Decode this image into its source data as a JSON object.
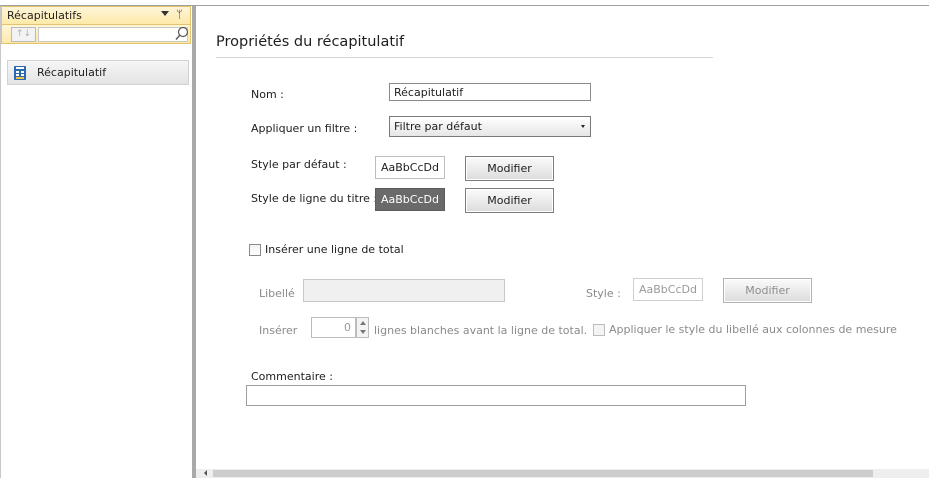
{
  "sidebar": {
    "title": "Récapitulatifs",
    "sort_icon": "↑↓",
    "search_placeholder": "",
    "items": [
      {
        "label": "Récapitulatif",
        "icon": "summary-table-icon"
      }
    ]
  },
  "panel": {
    "title": "Propriétés du récapitulatif",
    "name_label": "Nom :",
    "name_value": "Récapitulatif",
    "filter_label": "Appliquer un filtre :",
    "filter_value": "Filtre par défaut",
    "default_style_label": "Style par défaut :",
    "default_style_preview": "AaBbCcDd",
    "default_style_button": "Modifier",
    "title_style_label": "Style de ligne du titre :",
    "title_style_preview": "AaBbCcDd",
    "title_style_button": "Modifier",
    "total_checkbox_label": "Insérer une ligne de total",
    "total_checked": false,
    "libelle_label": "Libellé",
    "libelle_value": "",
    "total_style_label": "Style :",
    "total_style_preview": "AaBbCcDd",
    "total_style_button": "Modifier",
    "insert_label": "Insérer",
    "blank_lines_value": "0",
    "blank_lines_suffix": "lignes blanches avant la ligne de total.",
    "apply_style_label": "Appliquer le style du libellé aux colonnes de mesure",
    "comment_label": "Commentaire :",
    "comment_value": ""
  },
  "colors": {
    "header_gradient_top": "#fff6d9",
    "header_gradient_bottom": "#fde9a9",
    "dark_preview": "#6a6a6a",
    "splitter": "#a9a9a9"
  }
}
